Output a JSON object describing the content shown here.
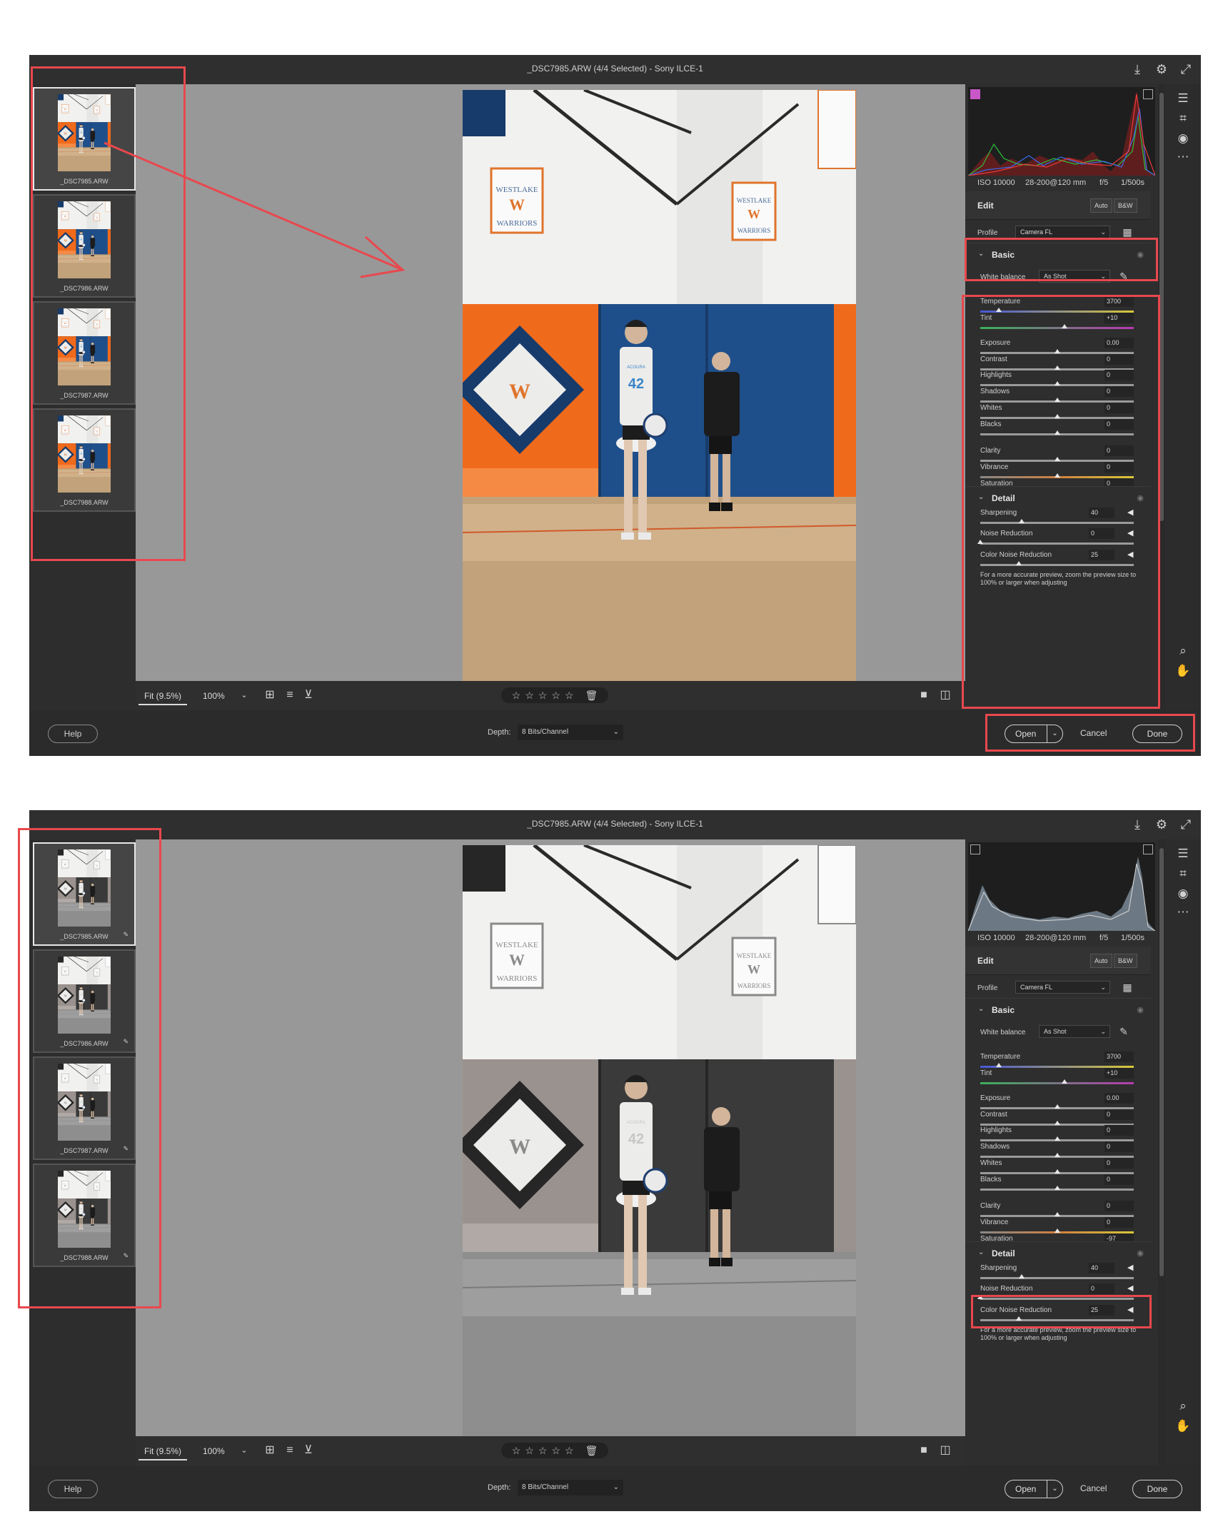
{
  "window_title": "_DSC7985.ARW (4/4 Selected)  -  Sony ILCE-1",
  "filmstrip": [
    {
      "name": "_DSC7985.ARW"
    },
    {
      "name": "_DSC7986.ARW"
    },
    {
      "name": "_DSC7987.ARW"
    },
    {
      "name": "_DSC7988.ARW"
    }
  ],
  "zoom": {
    "fit": "Fit (9.5%)",
    "full": "100%"
  },
  "rating_stars": "☆☆☆☆☆",
  "metadata": {
    "iso": "ISO 10000",
    "lens": "28-200@120 mm",
    "aperture": "f/5",
    "shutter": "1/500s"
  },
  "edit": {
    "title": "Edit",
    "auto": "Auto",
    "bw": "B&W"
  },
  "profile": {
    "label": "Profile",
    "value": "Camera FL"
  },
  "basic": {
    "title": "Basic",
    "white_balance_label": "White balance",
    "white_balance_value": "As Shot",
    "sliders": [
      {
        "label": "Temperature",
        "value": "3700",
        "pos": 0.12
      },
      {
        "label": "Tint",
        "value": "+10",
        "pos": 0.55
      },
      {
        "label": "Exposure",
        "value": "0.00",
        "pos": 0.5
      },
      {
        "label": "Contrast",
        "value": "0",
        "pos": 0.5
      },
      {
        "label": "Highlights",
        "value": "0",
        "pos": 0.5
      },
      {
        "label": "Shadows",
        "value": "0",
        "pos": 0.5
      },
      {
        "label": "Whites",
        "value": "0",
        "pos": 0.5
      },
      {
        "label": "Blacks",
        "value": "0",
        "pos": 0.5
      },
      {
        "label": "Clarity",
        "value": "0",
        "pos": 0.5
      },
      {
        "label": "Vibrance",
        "value": "0",
        "pos": 0.5
      },
      {
        "label": "Saturation",
        "value": "0",
        "pos": 0.5
      }
    ],
    "saturation_after": "-97"
  },
  "detail": {
    "title": "Detail",
    "sliders": [
      {
        "label": "Sharpening",
        "value": "40",
        "pos": 0.27
      },
      {
        "label": "Noise Reduction",
        "value": "0",
        "pos": 0.0
      },
      {
        "label": "Color Noise Reduction",
        "value": "25",
        "pos": 0.25
      }
    ],
    "note": "For a more accurate preview, zoom the preview size to 100% or larger when adjusting"
  },
  "footer": {
    "help": "Help",
    "depth_label": "Depth:",
    "depth_value": "8 Bits/Channel",
    "open": "Open",
    "cancel": "Cancel",
    "done": "Done"
  },
  "photo_text": {
    "sign_line1": "WESTLAKE",
    "sign_letter": "W",
    "sign_line2": "WARRIORS",
    "jersey": "ACOURA",
    "number": "42"
  },
  "colors": {
    "annotation": "#e8484e",
    "wall_blue": "#1f4f8a",
    "wall_orange": "#f06a1c"
  }
}
